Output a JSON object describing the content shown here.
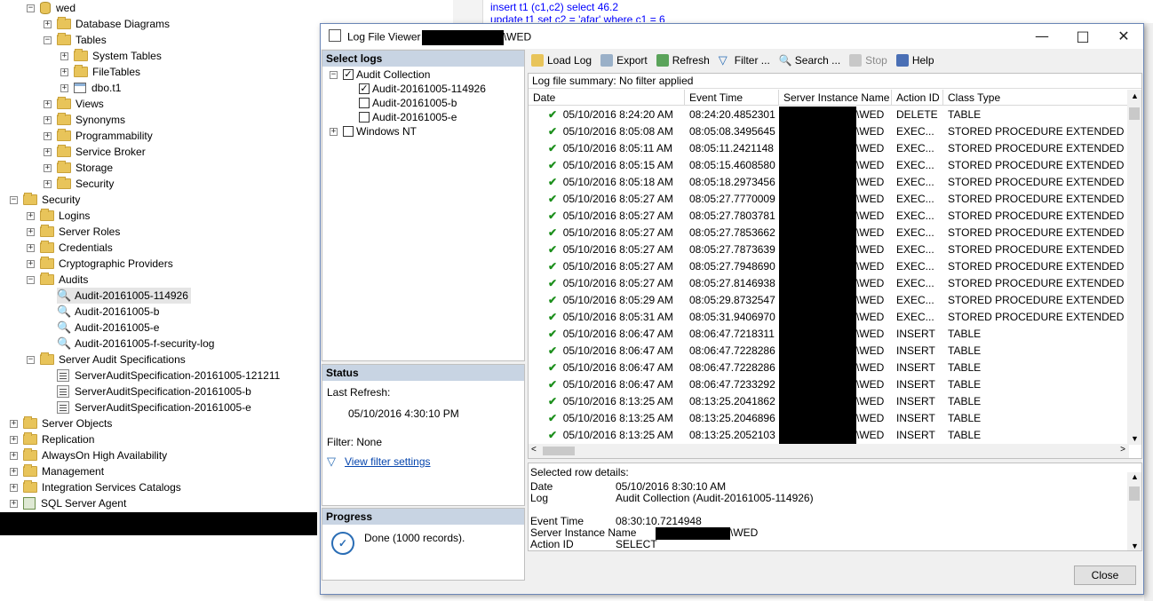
{
  "editor": {
    "line1": "insert t1 (c1,c2) select 46.2",
    "line2": "update t1 set c2 = 'afar' where c1 = 6"
  },
  "tree": {
    "db": "wed",
    "items": [
      {
        "label": "Database Diagrams",
        "icon": "folder-icon"
      },
      {
        "label": "Tables",
        "icon": "folder-icon"
      },
      {
        "label": "System Tables",
        "icon": "folder-icon"
      },
      {
        "label": "FileTables",
        "icon": "folder-icon"
      },
      {
        "label": "dbo.t1",
        "icon": "table-icon"
      },
      {
        "label": "Views",
        "icon": "folder-icon"
      },
      {
        "label": "Synonyms",
        "icon": "folder-icon"
      },
      {
        "label": "Programmability",
        "icon": "folder-icon"
      },
      {
        "label": "Service Broker",
        "icon": "folder-icon"
      },
      {
        "label": "Storage",
        "icon": "folder-icon"
      },
      {
        "label": "Security",
        "icon": "folder-icon"
      },
      {
        "label": "Security",
        "icon": "folder-icon"
      },
      {
        "label": "Logins",
        "icon": "folder-icon"
      },
      {
        "label": "Server Roles",
        "icon": "folder-icon"
      },
      {
        "label": "Credentials",
        "icon": "folder-icon"
      },
      {
        "label": "Cryptographic Providers",
        "icon": "folder-icon"
      },
      {
        "label": "Audits",
        "icon": "folder-icon"
      },
      {
        "label": "Audit-20161005-114926",
        "icon": "audit-icon"
      },
      {
        "label": "Audit-20161005-b",
        "icon": "audit-icon"
      },
      {
        "label": "Audit-20161005-e",
        "icon": "audit-icon"
      },
      {
        "label": "Audit-20161005-f-security-log",
        "icon": "audit-icon"
      },
      {
        "label": "Server Audit Specifications",
        "icon": "folder-icon"
      },
      {
        "label": "ServerAuditSpecification-20161005-121211",
        "icon": "spec-icon"
      },
      {
        "label": "ServerAuditSpecification-20161005-b",
        "icon": "spec-icon"
      },
      {
        "label": "ServerAuditSpecification-20161005-e",
        "icon": "spec-icon"
      },
      {
        "label": "Server Objects",
        "icon": "folder-icon"
      },
      {
        "label": "Replication",
        "icon": "folder-icon"
      },
      {
        "label": "AlwaysOn High Availability",
        "icon": "folder-icon"
      },
      {
        "label": "Management",
        "icon": "folder-icon"
      },
      {
        "label": "Integration Services Catalogs",
        "icon": "folder-icon"
      },
      {
        "label": "SQL Server Agent",
        "icon": "agent-icon"
      }
    ]
  },
  "viewer": {
    "title_prefix": "Log File Viewer -",
    "title_suffix": "\\WED",
    "select_logs": "Select logs",
    "logs": [
      {
        "label": "Audit Collection",
        "checked": true
      },
      {
        "label": "Audit-20161005-114926",
        "checked": true
      },
      {
        "label": "Audit-20161005-b",
        "checked": false
      },
      {
        "label": "Audit-20161005-e",
        "checked": false
      },
      {
        "label": "Windows NT",
        "checked": false
      }
    ],
    "status": {
      "header": "Status",
      "last_refresh_label": "Last Refresh:",
      "last_refresh": "05/10/2016 4:30:10 PM",
      "filter": "Filter: None",
      "view_filter": "View filter settings"
    },
    "progress": {
      "header": "Progress",
      "text": "Done (1000 records)."
    },
    "toolbar": {
      "load_log": "Load Log",
      "export": "Export",
      "refresh": "Refresh",
      "filter": "Filter ...",
      "search": "Search ...",
      "stop": "Stop",
      "help": "Help"
    },
    "summary": "Log file summary: No filter applied",
    "columns": [
      "Date",
      "Event Time",
      "Server Instance Name",
      "Action ID",
      "Class Type"
    ],
    "rows": [
      {
        "date": "05/10/2016 8:24:20 AM",
        "time": "08:24:20.4852301",
        "server": "\\WED",
        "action": "DELETE",
        "class": "TABLE"
      },
      {
        "date": "05/10/2016 8:05:08 AM",
        "time": "08:05:08.3495645",
        "server": "\\WED",
        "action": "EXEC...",
        "class": "STORED PROCEDURE EXTENDED"
      },
      {
        "date": "05/10/2016 8:05:11 AM",
        "time": "08:05:11.2421148",
        "server": "\\WED",
        "action": "EXEC...",
        "class": "STORED PROCEDURE EXTENDED"
      },
      {
        "date": "05/10/2016 8:05:15 AM",
        "time": "08:05:15.4608580",
        "server": "\\WED",
        "action": "EXEC...",
        "class": "STORED PROCEDURE EXTENDED"
      },
      {
        "date": "05/10/2016 8:05:18 AM",
        "time": "08:05:18.2973456",
        "server": "\\WED",
        "action": "EXEC...",
        "class": "STORED PROCEDURE EXTENDED"
      },
      {
        "date": "05/10/2016 8:05:27 AM",
        "time": "08:05:27.7770009",
        "server": "\\WED",
        "action": "EXEC...",
        "class": "STORED PROCEDURE EXTENDED"
      },
      {
        "date": "05/10/2016 8:05:27 AM",
        "time": "08:05:27.7803781",
        "server": "\\WED",
        "action": "EXEC...",
        "class": "STORED PROCEDURE EXTENDED"
      },
      {
        "date": "05/10/2016 8:05:27 AM",
        "time": "08:05:27.7853662",
        "server": "\\WED",
        "action": "EXEC...",
        "class": "STORED PROCEDURE EXTENDED"
      },
      {
        "date": "05/10/2016 8:05:27 AM",
        "time": "08:05:27.7873639",
        "server": "\\WED",
        "action": "EXEC...",
        "class": "STORED PROCEDURE EXTENDED"
      },
      {
        "date": "05/10/2016 8:05:27 AM",
        "time": "08:05:27.7948690",
        "server": "\\WED",
        "action": "EXEC...",
        "class": "STORED PROCEDURE EXTENDED"
      },
      {
        "date": "05/10/2016 8:05:27 AM",
        "time": "08:05:27.8146938",
        "server": "\\WED",
        "action": "EXEC...",
        "class": "STORED PROCEDURE EXTENDED"
      },
      {
        "date": "05/10/2016 8:05:29 AM",
        "time": "08:05:29.8732547",
        "server": "\\WED",
        "action": "EXEC...",
        "class": "STORED PROCEDURE EXTENDED"
      },
      {
        "date": "05/10/2016 8:05:31 AM",
        "time": "08:05:31.9406970",
        "server": "\\WED",
        "action": "EXEC...",
        "class": "STORED PROCEDURE EXTENDED"
      },
      {
        "date": "05/10/2016 8:06:47 AM",
        "time": "08:06:47.7218311",
        "server": "\\WED",
        "action": "INSERT",
        "class": "TABLE"
      },
      {
        "date": "05/10/2016 8:06:47 AM",
        "time": "08:06:47.7228286",
        "server": "\\WED",
        "action": "INSERT",
        "class": "TABLE"
      },
      {
        "date": "05/10/2016 8:06:47 AM",
        "time": "08:06:47.7228286",
        "server": "\\WED",
        "action": "INSERT",
        "class": "TABLE"
      },
      {
        "date": "05/10/2016 8:06:47 AM",
        "time": "08:06:47.7233292",
        "server": "\\WED",
        "action": "INSERT",
        "class": "TABLE"
      },
      {
        "date": "05/10/2016 8:13:25 AM",
        "time": "08:13:25.2041862",
        "server": "\\WED",
        "action": "INSERT",
        "class": "TABLE"
      },
      {
        "date": "05/10/2016 8:13:25 AM",
        "time": "08:13:25.2046896",
        "server": "\\WED",
        "action": "INSERT",
        "class": "TABLE"
      },
      {
        "date": "05/10/2016 8:13:25 AM",
        "time": "08:13:25.2052103",
        "server": "\\WED",
        "action": "INSERT",
        "class": "TABLE"
      }
    ],
    "details": {
      "header": "Selected row details:",
      "fields": [
        {
          "label": "Date",
          "value": "05/10/2016 8:30:10 AM"
        },
        {
          "label": "Log",
          "value": "Audit Collection (Audit-20161005-114926)"
        },
        {
          "label": "Event Time",
          "value": "08:30:10.7214948"
        },
        {
          "label": "Server Instance Name",
          "value": "\\WED"
        },
        {
          "label": "Action ID",
          "value": "SELECT"
        }
      ]
    },
    "close": "Close"
  }
}
